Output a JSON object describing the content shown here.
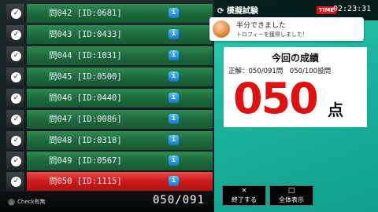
{
  "questions": [
    {
      "label": "問042 [ID:0681]",
      "check": "✓",
      "info": "i"
    },
    {
      "label": "問043 [ID:0433]",
      "check": "✓",
      "info": "i"
    },
    {
      "label": "問044 [ID:1031]",
      "check": "✓",
      "info": "i"
    },
    {
      "label": "問045 [ID:0500]",
      "check": "✓",
      "info": "i"
    },
    {
      "label": "問046 [ID:0440]",
      "check": "✓",
      "info": "i"
    },
    {
      "label": "問047 [ID:0086]",
      "check": "✓",
      "info": "i"
    },
    {
      "label": "問048 [ID:0318]",
      "check": "✓",
      "info": "i"
    },
    {
      "label": "問049 [ID:0567]",
      "check": "✓",
      "info": "i"
    },
    {
      "label": "問050 [ID:1115]",
      "check": "✓",
      "info": "i"
    }
  ],
  "footer": {
    "check_legend_icon": "△",
    "check_legend": "Check有無",
    "progress": "050/091"
  },
  "header": {
    "mode_title": "⟳ 模擬試験",
    "time_badge": "TIME",
    "clock": "02:23:31"
  },
  "toast": {
    "title": "半分できました",
    "subtitle": "トロフィーを獲得しました！"
  },
  "result": {
    "title": "今回の成績",
    "line": "正解：050/091問　050/100設問",
    "score": "050",
    "unit": "点"
  },
  "buttons": {
    "end": {
      "glyph": "×",
      "label": "終了する"
    },
    "all": {
      "glyph": "□",
      "label": "全体表示"
    }
  },
  "colors": {
    "accent_green": "#1d6a3d",
    "selected_red": "#cc1a1a",
    "panel_teal": "#1cb59d",
    "score_red": "#e01010"
  }
}
